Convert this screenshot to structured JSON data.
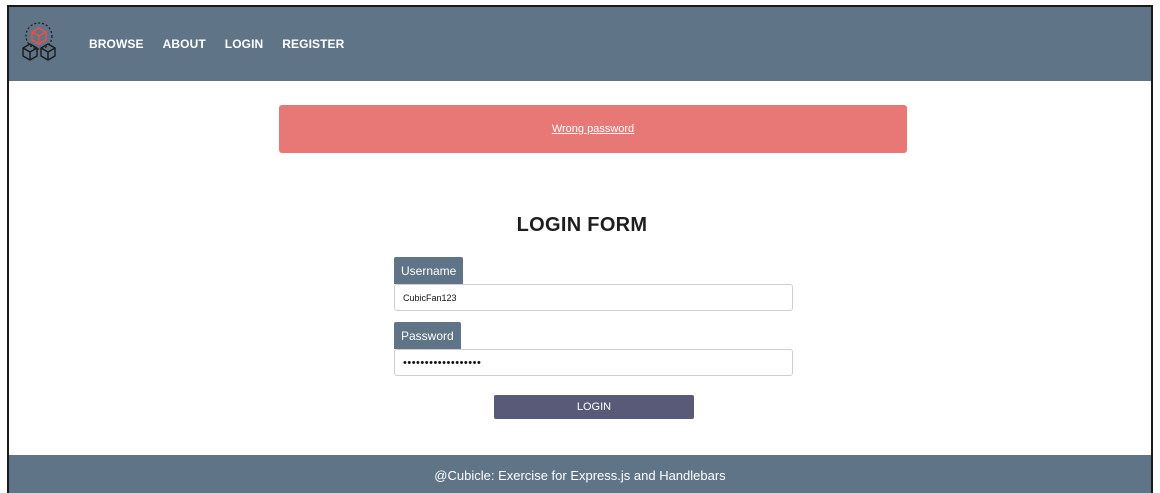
{
  "nav": {
    "logo_icon": "cube-stack-icon",
    "items": [
      {
        "label": "BROWSE"
      },
      {
        "label": "ABOUT"
      },
      {
        "label": "LOGIN"
      },
      {
        "label": "REGISTER"
      }
    ]
  },
  "alert": {
    "message": "Wrong password",
    "color": "#e77876"
  },
  "form": {
    "title": "LOGIN FORM",
    "username": {
      "label": "Username",
      "value": "CubicFan123"
    },
    "password": {
      "label": "Password",
      "value": "••••••••••••••••••"
    },
    "submit_label": "LOGIN"
  },
  "footer": {
    "text": "@Cubicle: Exercise for Express.js and Handlebars"
  },
  "colors": {
    "header_bg": "#607487",
    "button_bg": "#595a78"
  }
}
